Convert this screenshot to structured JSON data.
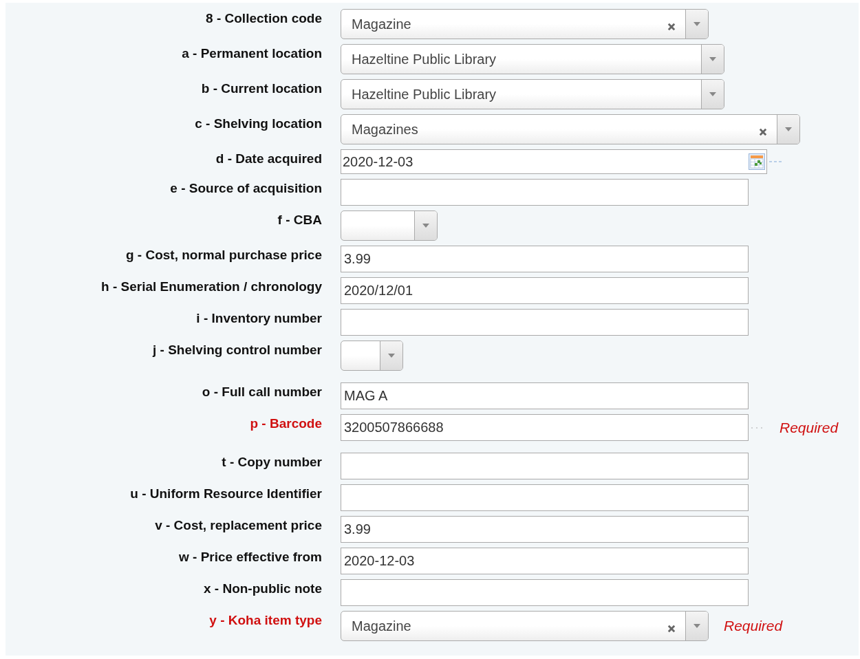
{
  "fields": [
    {
      "label": "8 - Collection code",
      "kind": "select",
      "value": "Magazine",
      "clearable": true,
      "required": false
    },
    {
      "label": "a - Permanent location",
      "kind": "select",
      "value": "Hazeltine Public Library",
      "clearable": false,
      "required": false
    },
    {
      "label": "b - Current location",
      "kind": "select",
      "value": "Hazeltine Public Library",
      "clearable": false,
      "required": false
    },
    {
      "label": "c - Shelving location",
      "kind": "select",
      "value": "Magazines",
      "clearable": true,
      "required": false
    },
    {
      "label": "d - Date acquired",
      "kind": "date",
      "value": "2020-12-03",
      "required": false
    },
    {
      "label": "e - Source of acquisition",
      "kind": "text",
      "required": false
    },
    {
      "label": "f - CBA",
      "kind": "select",
      "clearable": false,
      "required": false
    },
    {
      "label": "g - Cost, normal purchase price",
      "kind": "text",
      "value": "3.99",
      "required": false
    },
    {
      "label": "h - Serial Enumeration / chronology",
      "kind": "text",
      "value": "2020/12/01",
      "required": false
    },
    {
      "label": "i - Inventory number",
      "kind": "text",
      "required": false
    },
    {
      "label": "j - Shelving control number",
      "kind": "select",
      "clearable": false,
      "required": false
    },
    {
      "label": "o - Full call number",
      "kind": "text",
      "value": "MAG A",
      "required": false
    },
    {
      "label": "p - Barcode",
      "kind": "text",
      "value": "3200507866688",
      "required": true,
      "note": "Required"
    },
    {
      "label": "t - Copy number",
      "kind": "text",
      "required": false
    },
    {
      "label": "u - Uniform Resource Identifier",
      "kind": "text",
      "required": false
    },
    {
      "label": "v - Cost, replacement price",
      "kind": "text",
      "value": "3.99",
      "required": false
    },
    {
      "label": "w - Price effective from",
      "kind": "text",
      "value": "2020-12-03",
      "required": false
    },
    {
      "label": "x - Non-public note",
      "kind": "text",
      "required": false
    },
    {
      "label": "y - Koha item type",
      "kind": "select",
      "value": "Magazine",
      "clearable": true,
      "required": true,
      "note": "Required"
    }
  ]
}
